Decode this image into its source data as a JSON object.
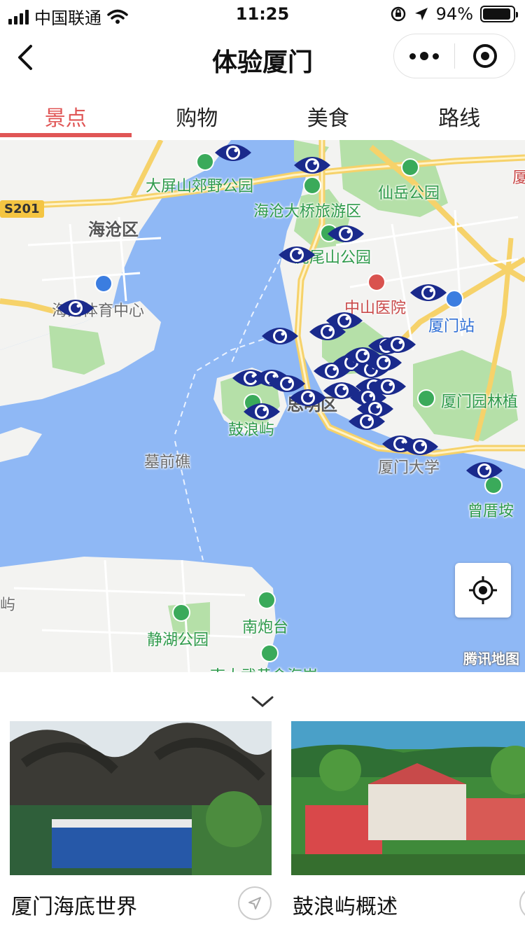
{
  "status_bar": {
    "carrier": "中国联通",
    "time": "11:25",
    "battery_text": "94%",
    "battery_level": 0.94
  },
  "nav": {
    "title": "体验厦门"
  },
  "tabs": [
    {
      "label": "景点",
      "active": true
    },
    {
      "label": "购物",
      "active": false
    },
    {
      "label": "美食",
      "active": false
    },
    {
      "label": "路线",
      "active": false
    }
  ],
  "map": {
    "road_shield": "S201",
    "labels": {
      "dapingshan": "大屏山郊野公园",
      "xianyue": "仙岳公园",
      "haicang_bridge": "海沧大桥旅游区",
      "haicang": "海沧区",
      "huweishan": "虎尾山公园",
      "zhongshan_hospital": "中山医院",
      "sports_center": "海沧体育中心",
      "xiamen_station": "厦门站",
      "yuanlin": "厦门园林植",
      "gulangyu": "鼓浪屿",
      "siming": "思明区",
      "muqianjiao": "墓前礁",
      "xmu": "厦门大学",
      "zengcuoan": "曾厝垵",
      "yu": "屿",
      "jinghu": "静湖公园",
      "nanpaotai": "南炮台",
      "partial_bottom": "南太武黄金海岸",
      "edge": "厦"
    },
    "watermark": "腾讯地图"
  },
  "colors": {
    "accent": "#e05656",
    "water": "#8fb8f5",
    "land": "#f5f5f3",
    "park": "#b5e0a8",
    "road": "#f6d26a",
    "marker": "#1a2a8c"
  },
  "cards": [
    {
      "title": "厦门海底世界"
    },
    {
      "title": "鼓浪屿概述"
    }
  ]
}
